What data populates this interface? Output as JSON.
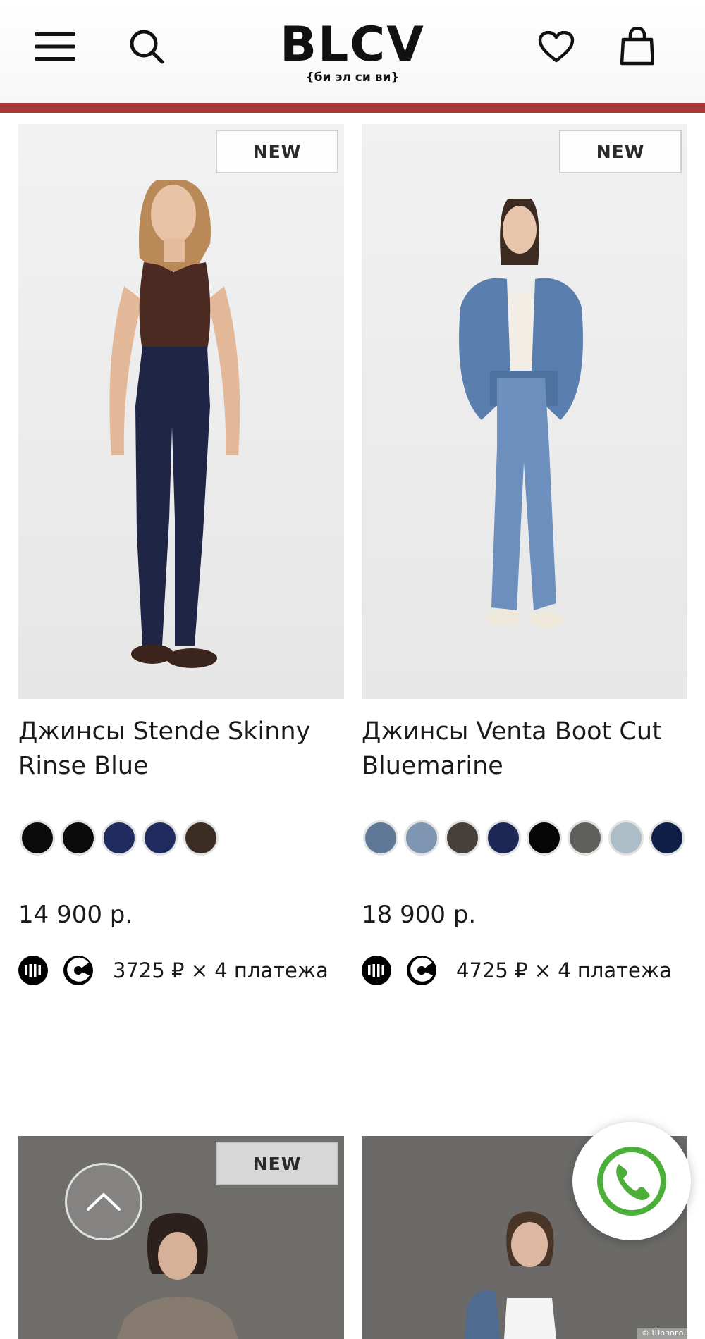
{
  "header": {
    "logo_text": "BLCV",
    "logo_subtitle": "{би эл си ви}",
    "accent_color": "#a83838"
  },
  "icons": {
    "menu": "hamburger-menu-icon",
    "search": "search-icon",
    "wishlist": "heart-icon",
    "cart": "shopping-bag-icon",
    "scroll_top": "chevron-up-icon",
    "call": "phone-icon"
  },
  "products": [
    {
      "badge": "NEW",
      "title": "Джинсы Stende Skinny Rinse Blue",
      "swatches": [
        "#0b0b0b",
        "#0b0b0b",
        "#1f2a5e",
        "#1f2a5e",
        "#3b2c24"
      ],
      "price": "14 900 р.",
      "installment": "3725 ₽ × 4 платежа"
    },
    {
      "badge": "NEW",
      "title": "Джинсы Venta Boot Cut Bluemarine",
      "swatches": [
        "#5e7895",
        "#7e96b2",
        "#47403a",
        "#1c2755",
        "#050505",
        "#5f605c",
        "#adbdc7",
        "#0f1f45"
      ],
      "price": "18 900 р.",
      "installment": "4725 ₽ × 4 платежа"
    },
    {
      "badge": "NEW"
    },
    {
      "badge": ""
    }
  ],
  "watermark": "© Шопого..."
}
